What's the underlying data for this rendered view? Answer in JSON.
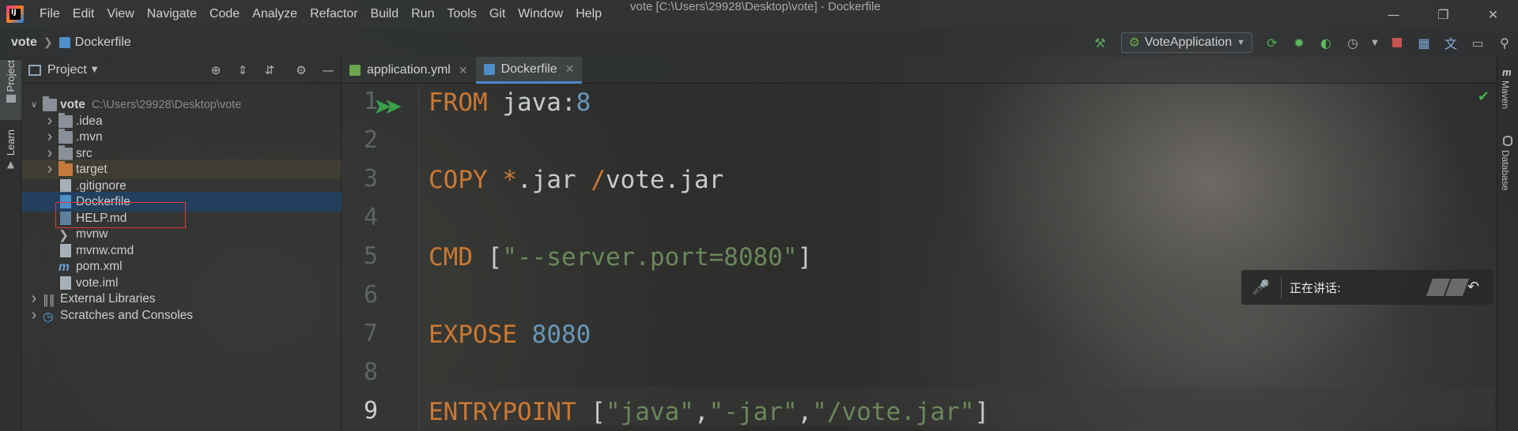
{
  "titlebar": {
    "menu": [
      "File",
      "Edit",
      "View",
      "Navigate",
      "Code",
      "Analyze",
      "Refactor",
      "Build",
      "Run",
      "Tools",
      "Git",
      "Window",
      "Help"
    ],
    "window_title": "vote [C:\\Users\\29928\\Desktop\\vote] - Dockerfile",
    "controls": [
      "minimize",
      "restore",
      "close"
    ]
  },
  "navbar": {
    "breadcrumb": [
      "vote",
      "Dockerfile"
    ],
    "run_config": "VoteApplication"
  },
  "left_strip": {
    "tabs": [
      "Project",
      "Learn"
    ]
  },
  "right_strip": {
    "tabs": [
      "Maven",
      "Database"
    ]
  },
  "project_panel": {
    "title": "Project",
    "tree": [
      {
        "label": "vote",
        "detail": "C:\\Users\\29928\\Desktop\\vote",
        "kind": "module"
      },
      {
        "label": ".idea",
        "kind": "folder"
      },
      {
        "label": ".mvn",
        "kind": "folder"
      },
      {
        "label": "src",
        "kind": "folder"
      },
      {
        "label": "target",
        "kind": "folder-excluded"
      },
      {
        "label": ".gitignore",
        "kind": "file"
      },
      {
        "label": "Dockerfile",
        "kind": "docker",
        "selected": true
      },
      {
        "label": "HELP.md",
        "kind": "md"
      },
      {
        "label": "mvnw",
        "kind": "script"
      },
      {
        "label": "mvnw.cmd",
        "kind": "file"
      },
      {
        "label": "pom.xml",
        "kind": "maven"
      },
      {
        "label": "vote.iml",
        "kind": "file"
      },
      {
        "label": "External Libraries",
        "kind": "libs"
      },
      {
        "label": "Scratches and Consoles",
        "kind": "scratches"
      }
    ]
  },
  "editor": {
    "tabs": [
      {
        "label": "application.yml",
        "active": false
      },
      {
        "label": "Dockerfile",
        "active": true
      }
    ],
    "line_numbers": [
      "1",
      "2",
      "3",
      "4",
      "5",
      "6",
      "7",
      "8",
      "9"
    ],
    "lines": [
      [
        {
          "t": "FROM",
          "c": "kw"
        },
        {
          "t": " java:",
          "c": "tx"
        },
        {
          "t": "8",
          "c": "num"
        }
      ],
      [],
      [
        {
          "t": "COPY",
          "c": "kw"
        },
        {
          "t": " ",
          "c": "tx"
        },
        {
          "t": "*",
          "c": "kw"
        },
        {
          "t": ".jar ",
          "c": "tx"
        },
        {
          "t": "/",
          "c": "kw"
        },
        {
          "t": "vote.jar",
          "c": "tx"
        }
      ],
      [],
      [
        {
          "t": "CMD",
          "c": "kw"
        },
        {
          "t": " [",
          "c": "tx"
        },
        {
          "t": "\"--server.port=8080\"",
          "c": "str"
        },
        {
          "t": "]",
          "c": "tx"
        }
      ],
      [],
      [
        {
          "t": "EXPOSE",
          "c": "kw"
        },
        {
          "t": " ",
          "c": "tx"
        },
        {
          "t": "8080",
          "c": "num"
        }
      ],
      [],
      [
        {
          "t": "ENTRYPOINT",
          "c": "kw"
        },
        {
          "t": " [",
          "c": "tx"
        },
        {
          "t": "\"java\"",
          "c": "str"
        },
        {
          "t": ",",
          "c": "tx"
        },
        {
          "t": "\"-jar\"",
          "c": "str"
        },
        {
          "t": ",",
          "c": "tx"
        },
        {
          "t": "\"/vote.jar\"",
          "c": "str"
        },
        {
          "t": "]",
          "c": "tx"
        }
      ]
    ]
  },
  "speaking_widget": {
    "label": "正在讲话:"
  },
  "colors": {
    "keyword": "#cc7832",
    "number": "#6897bb",
    "string": "#6a8759",
    "selection": "#214266",
    "highlight_box": "#d83c3c"
  }
}
